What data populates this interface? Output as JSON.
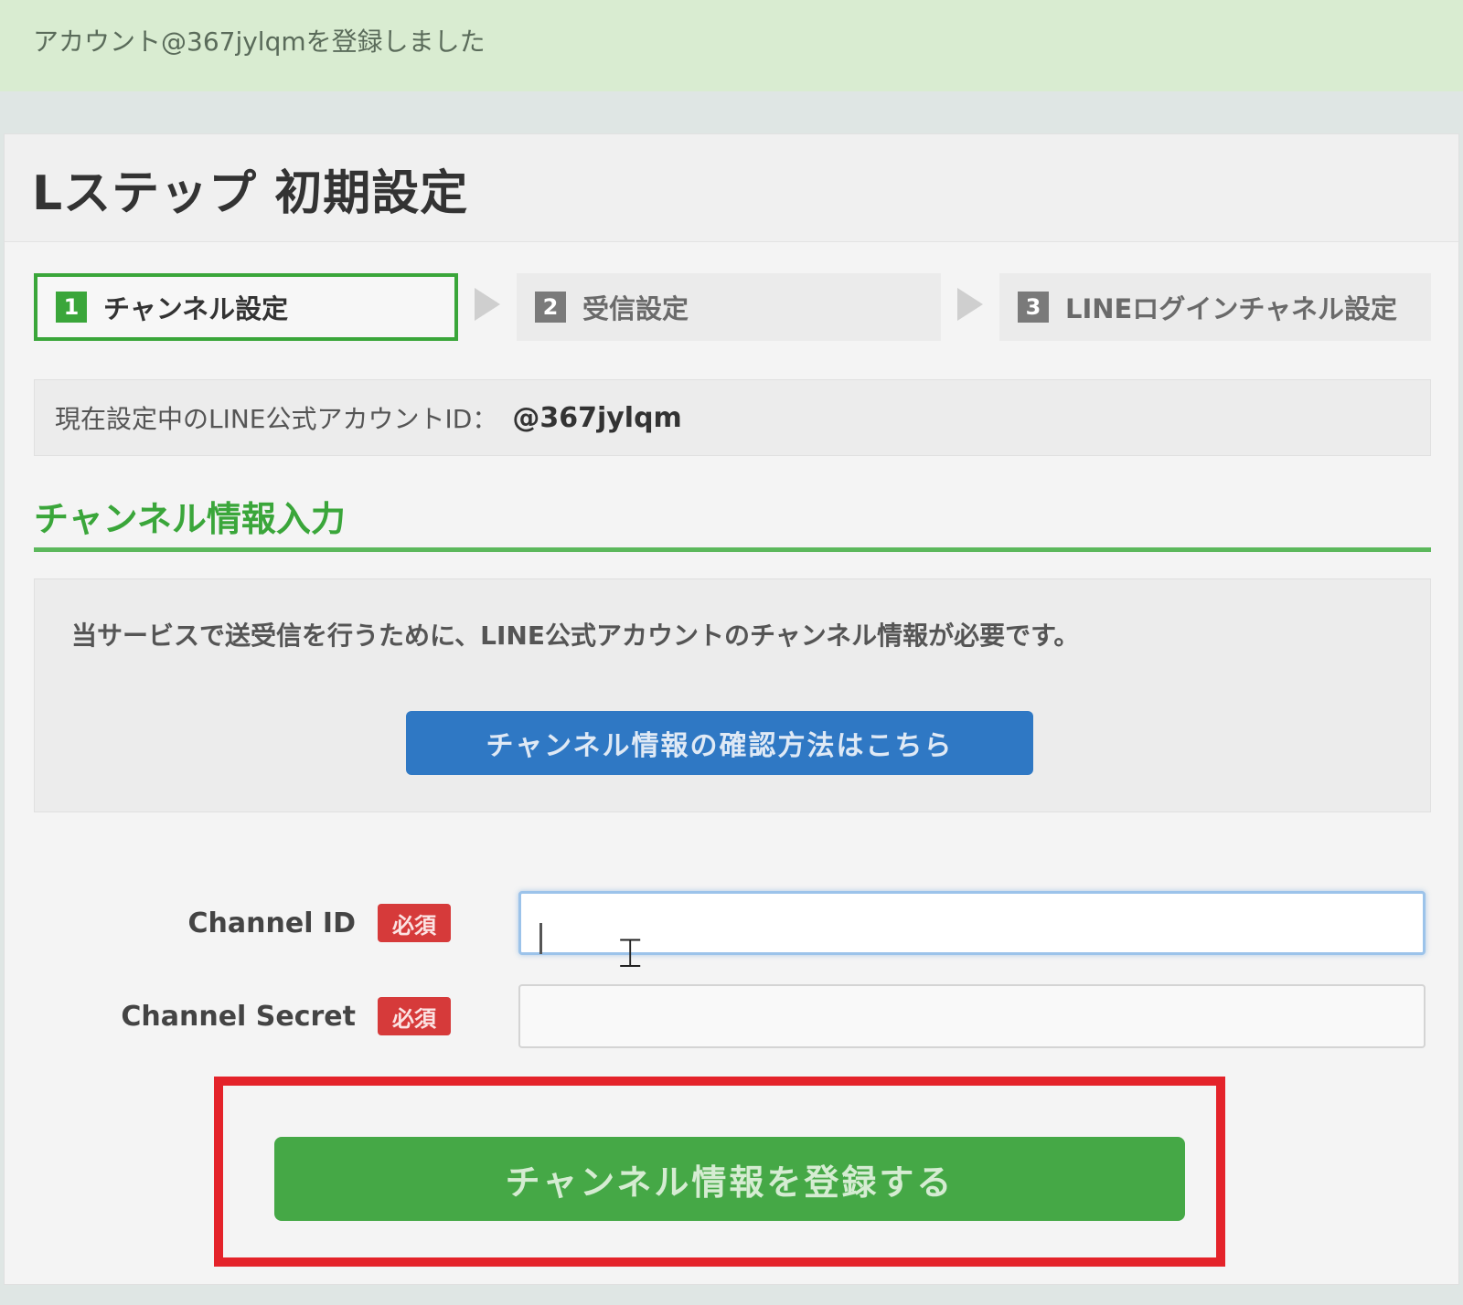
{
  "alert": {
    "message": "アカウント@367jylqmを登録しました"
  },
  "panel": {
    "title": "Lステップ 初期設定"
  },
  "steps": [
    {
      "number": "1",
      "label": "チャンネル設定",
      "active": true
    },
    {
      "number": "2",
      "label": "受信設定",
      "active": false
    },
    {
      "number": "3",
      "label": "LINEログインチャネル設定",
      "active": false
    }
  ],
  "current_account": {
    "label": "現在設定中のLINE公式アカウントID：",
    "value": "@367jylqm"
  },
  "section": {
    "heading": "チャンネル情報入力"
  },
  "info": {
    "text": "当サービスで送受信を行うために、LINE公式アカウントのチャンネル情報が必要です。",
    "help_button": "チャンネル情報の確認方法はこちら"
  },
  "form": {
    "fields": [
      {
        "label": "Channel ID",
        "badge": "必須",
        "value": "",
        "placeholder": ""
      },
      {
        "label": "Channel Secret",
        "badge": "必須",
        "value": "",
        "placeholder": ""
      }
    ],
    "submit_label": "チャンネル情報を登録する"
  },
  "colors": {
    "brand_green": "#3aa63a",
    "button_blue": "#2f78c4",
    "required_red": "#d63a3a",
    "highlight_red": "#e4232a"
  },
  "icons": {
    "step_arrow": "triangle-right-icon",
    "cursor": "text-cursor-icon"
  }
}
